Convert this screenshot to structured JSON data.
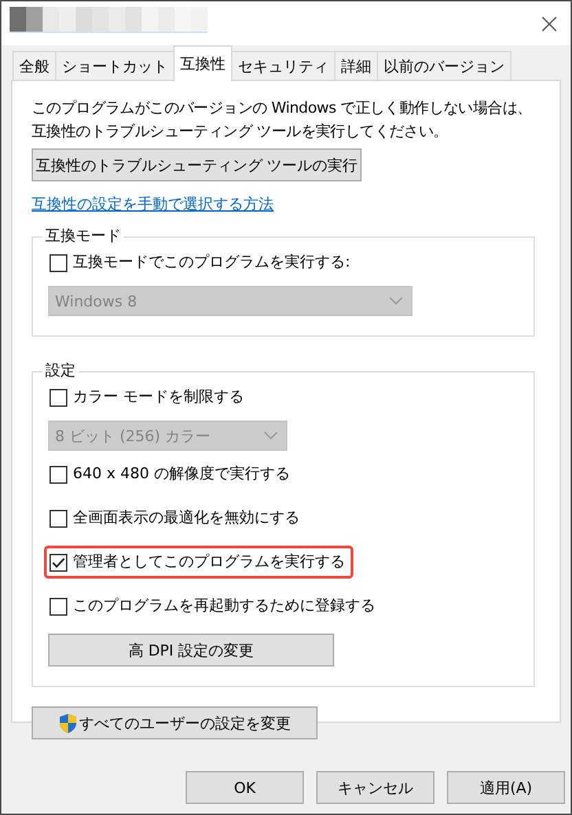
{
  "window": {
    "title_redacted": true
  },
  "tabs": [
    {
      "label": "全般",
      "selected": false
    },
    {
      "label": "ショートカット",
      "selected": false
    },
    {
      "label": "互換性",
      "selected": true
    },
    {
      "label": "セキュリティ",
      "selected": false
    },
    {
      "label": "詳細",
      "selected": false
    },
    {
      "label": "以前のバージョン",
      "selected": false
    }
  ],
  "description": "このプログラムがこのバージョンの Windows で正しく動作しない場合は、互換性のトラブルシューティング ツールを実行してください。",
  "troubleshoot_button": "互換性のトラブルシューティング ツールの実行",
  "help_link": "互換性の設定を手動で選択する方法",
  "groups": [
    {
      "title": "互換モード",
      "items": [
        {
          "kind": "checkbox",
          "label": "互換モードでこのプログラムを実行する:",
          "checked": false,
          "highlighted": false
        },
        {
          "kind": "dropdown",
          "value": "Windows 8",
          "disabled": true
        }
      ]
    },
    {
      "title": "設定",
      "items": [
        {
          "kind": "checkbox",
          "label": "カラー モードを制限する",
          "checked": false,
          "highlighted": false
        },
        {
          "kind": "dropdown",
          "value": "8 ビット (256) カラー",
          "disabled": true
        },
        {
          "kind": "checkbox",
          "label": "640 x 480 の解像度で実行する",
          "checked": false,
          "highlighted": false
        },
        {
          "kind": "checkbox",
          "label": "全画面表示の最適化を無効にする",
          "checked": false,
          "highlighted": false
        },
        {
          "kind": "checkbox",
          "label": "管理者としてこのプログラムを実行する",
          "checked": true,
          "highlighted": true
        },
        {
          "kind": "checkbox",
          "label": "このプログラムを再起動するために登録する",
          "checked": false,
          "highlighted": false
        },
        {
          "kind": "button",
          "label": "高 DPI 設定の変更"
        }
      ]
    }
  ],
  "all_users_button": "すべてのユーザーの設定を変更",
  "footer_buttons": [
    "OK",
    "キャンセル",
    "適用(A)"
  ]
}
